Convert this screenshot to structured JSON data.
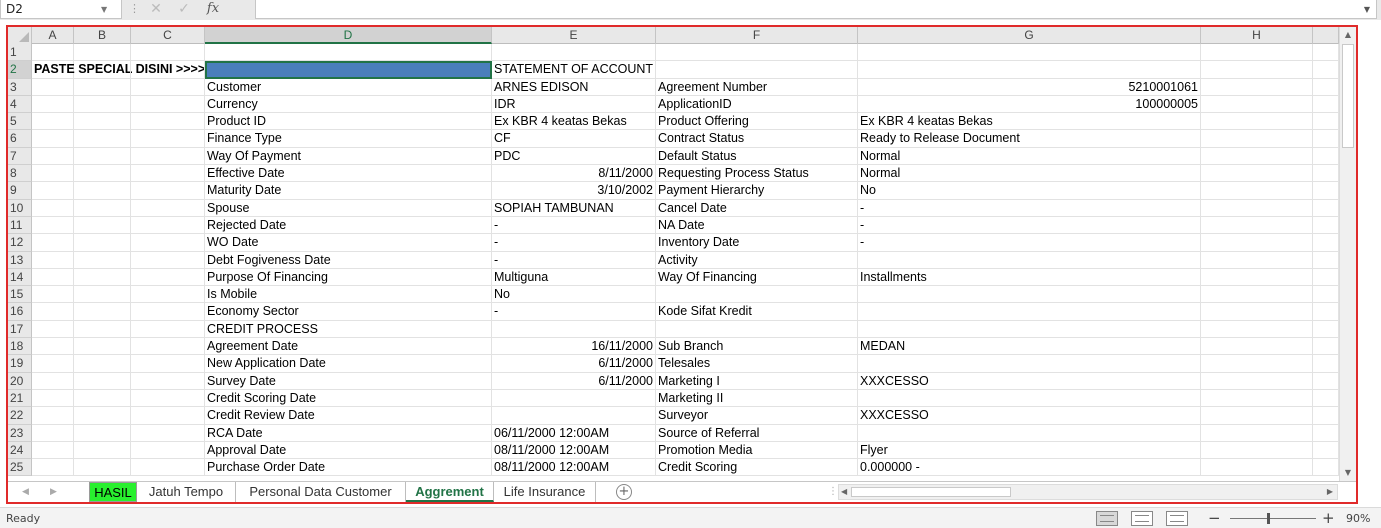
{
  "formula_bar": {
    "name_box": "D2",
    "fx_label": "fx",
    "formula_value": ""
  },
  "colors": {
    "accent": "#217346",
    "highlight_border": "#e02a2a",
    "selected_cell": "#4a7ebb",
    "tab_hasil": "#28f02e"
  },
  "columns": [
    "A",
    "B",
    "C",
    "D",
    "E",
    "F",
    "G",
    "H"
  ],
  "selected_column": "D",
  "rows": [
    {
      "n": "1",
      "a": "",
      "d": "",
      "e": "",
      "f": "",
      "g": ""
    },
    {
      "n": "2",
      "a": "PASTE SPECIAL DISINI >>>>>",
      "d": "",
      "e": "STATEMENT OF ACCOUNT",
      "f": "",
      "g": ""
    },
    {
      "n": "3",
      "a": "",
      "d": "Customer",
      "e": "ARNES EDISON",
      "f": "Agreement Number",
      "g": "5210001061"
    },
    {
      "n": "4",
      "a": "",
      "d": "Currency",
      "e": "IDR",
      "f": "ApplicationID",
      "g": "100000005"
    },
    {
      "n": "5",
      "a": "",
      "d": "Product ID",
      "e": "Ex KBR 4 keatas Bekas",
      "f": "Product Offering",
      "g": "Ex KBR 4 keatas Bekas"
    },
    {
      "n": "6",
      "a": "",
      "d": "Finance Type",
      "e": "CF",
      "f": "Contract Status",
      "g": "Ready to Release Document"
    },
    {
      "n": "7",
      "a": "",
      "d": "Way Of Payment",
      "e": "PDC",
      "f": "Default Status",
      "g": "Normal"
    },
    {
      "n": "8",
      "a": "",
      "d": "Effective Date",
      "e": "8/11/2000",
      "f": "Requesting Process Status",
      "g": "Normal"
    },
    {
      "n": "9",
      "a": "",
      "d": "Maturity Date",
      "e": "3/10/2002",
      "f": "Payment Hierarchy",
      "g": "No"
    },
    {
      "n": "10",
      "a": "",
      "d": "Spouse",
      "e": "SOPIAH TAMBUNAN",
      "f": "Cancel Date",
      "g": "-"
    },
    {
      "n": "11",
      "a": "",
      "d": "Rejected Date",
      "e": "-",
      "f": "NA Date",
      "g": "-"
    },
    {
      "n": "12",
      "a": "",
      "d": "WO Date",
      "e": "-",
      "f": "Inventory Date",
      "g": "-"
    },
    {
      "n": "13",
      "a": "",
      "d": "Debt Fogiveness Date",
      "e": "-",
      "f": "Activity",
      "g": ""
    },
    {
      "n": "14",
      "a": "",
      "d": "Purpose Of Financing",
      "e": "Multiguna",
      "f": "Way Of Financing",
      "g": "Installments"
    },
    {
      "n": "15",
      "a": "",
      "d": "Is Mobile",
      "e": "No",
      "f": "",
      "g": ""
    },
    {
      "n": "16",
      "a": "",
      "d": "Economy Sector",
      "e": "-",
      "f": "Kode Sifat Kredit",
      "g": ""
    },
    {
      "n": "17",
      "a": "",
      "d": "CREDIT PROCESS",
      "e": "",
      "f": "",
      "g": ""
    },
    {
      "n": "18",
      "a": "",
      "d": "Agreement Date",
      "e": "16/11/2000",
      "f": "Sub Branch",
      "g": "MEDAN"
    },
    {
      "n": "19",
      "a": "",
      "d": "New Application Date",
      "e": "6/11/2000",
      "f": "Telesales",
      "g": ""
    },
    {
      "n": "20",
      "a": "",
      "d": "Survey Date",
      "e": "6/11/2000",
      "f": "Marketing I",
      "g": "XXXCESSO"
    },
    {
      "n": "21",
      "a": "",
      "d": "Credit Scoring Date",
      "e": "",
      "f": "Marketing II",
      "g": ""
    },
    {
      "n": "22",
      "a": "",
      "d": "Credit Review Date",
      "e": "",
      "f": "Surveyor",
      "g": "XXXCESSO"
    },
    {
      "n": "23",
      "a": "",
      "d": "RCA Date",
      "e": "06/11/2000 12:00AM",
      "f": "Source of Referral",
      "g": ""
    },
    {
      "n": "24",
      "a": "",
      "d": "Approval Date",
      "e": "08/11/2000 12:00AM",
      "f": "Promotion Media",
      "g": "Flyer"
    },
    {
      "n": "25",
      "a": "",
      "d": "Purchase Order Date",
      "e": "08/11/2000 12:00AM",
      "f": "Credit Scoring",
      "g": "0.000000 -"
    }
  ],
  "sheet_tabs": [
    "HASIL",
    "Jatuh Tempo",
    "Personal Data Customer",
    "Aggrement",
    "Life Insurance"
  ],
  "active_tab": "Aggrement",
  "status": {
    "ready": "Ready",
    "zoom": "90%"
  }
}
